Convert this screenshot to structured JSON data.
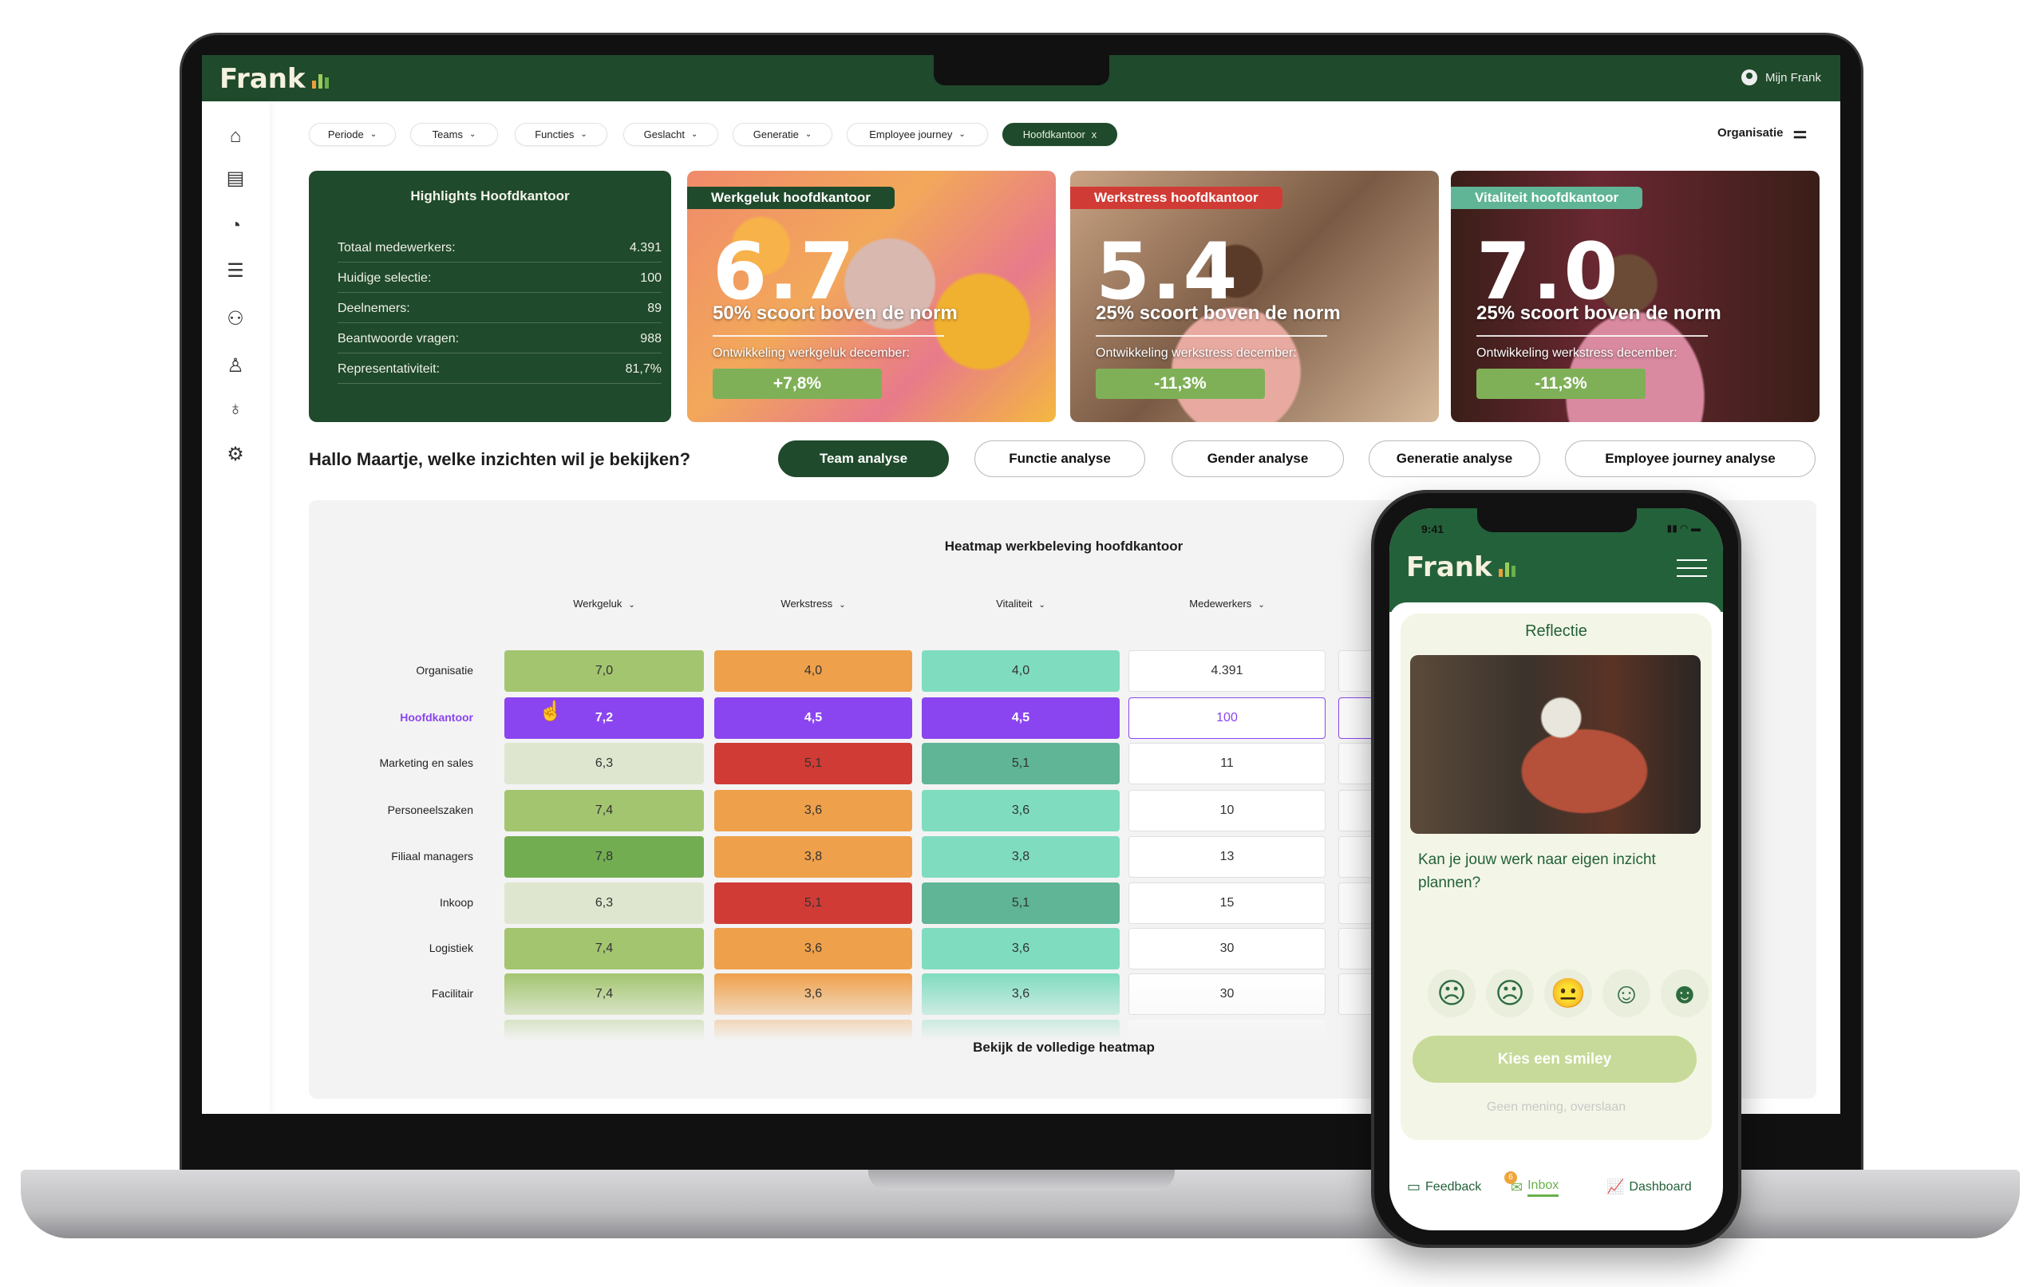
{
  "app": {
    "logo": "Frank",
    "user_label": "Mijn Frank",
    "org_label": "Organisatie",
    "logo_bar_colors": [
      "#e8a03b",
      "#9ccc5a",
      "#6ab04c"
    ]
  },
  "sidebar": {
    "items": [
      {
        "icon": "home-icon"
      },
      {
        "icon": "report-icon"
      },
      {
        "icon": "pie-chart-icon"
      },
      {
        "icon": "sliders-icon"
      },
      {
        "icon": "award-icon"
      },
      {
        "icon": "user-icon"
      },
      {
        "icon": "lightbulb-icon"
      },
      {
        "icon": "gear-icon"
      }
    ]
  },
  "filters": [
    {
      "label": "Periode"
    },
    {
      "label": "Teams"
    },
    {
      "label": "Functies"
    },
    {
      "label": "Geslacht"
    },
    {
      "label": "Generatie"
    },
    {
      "label": "Employee journey"
    },
    {
      "label": "Hoofdkantoor",
      "active": true,
      "close": "x"
    }
  ],
  "highlights": {
    "title": "Highlights Hoofdkantoor",
    "rows": [
      {
        "label": "Totaal medewerkers:",
        "value": "4.391"
      },
      {
        "label": "Huidige selectie:",
        "value": "100"
      },
      {
        "label": "Deelnemers:",
        "value": "89"
      },
      {
        "label": "Beantwoorde vragen:",
        "value": "988"
      },
      {
        "label": "Representativiteit:",
        "value": "81,7%"
      }
    ]
  },
  "score_cards": [
    {
      "tag": "Werkgeluk hoofdkantoor",
      "score": "6.7",
      "norm": "50% scoort boven de norm",
      "development": "Ontwikkeling werkgeluk december:",
      "delta": "+7,8%",
      "tag_color": "#1f4a2b"
    },
    {
      "tag": "Werkstress hoofdkantoor",
      "score": "5.4",
      "norm": "25% scoort boven de norm",
      "development": "Ontwikkeling werkstress december:",
      "delta": "-11,3%",
      "tag_color": "#d13b35"
    },
    {
      "tag": "Vitaliteit hoofdkantoor",
      "score": "7.0",
      "norm": "25% scoort boven de norm",
      "development": "Ontwikkeling werkstress december:",
      "delta": "-11,3%",
      "tag_color": "#5fb596"
    }
  ],
  "question": "Hallo Maartje, welke inzichten wil je bekijken?",
  "analysis_buttons": [
    {
      "label": "Team analyse",
      "active": true
    },
    {
      "label": "Functie analyse"
    },
    {
      "label": "Gender analyse"
    },
    {
      "label": "Generatie analyse"
    },
    {
      "label": "Employee journey analyse"
    }
  ],
  "heatmap": {
    "title": "Heatmap werkbeleving hoofdkantoor",
    "columns": [
      "Werkgeluk",
      "Werkstress",
      "Vitaliteit",
      "Medewerkers"
    ],
    "rows": [
      {
        "label": "Organisatie",
        "cells": [
          [
            "7,0",
            "#a3c56f"
          ],
          [
            "4,0",
            "#efa04b"
          ],
          [
            "4,0",
            "#7fdcbf"
          ],
          [
            "4.391",
            "#ffffff"
          ]
        ]
      },
      {
        "label": "Hoofdkantoor",
        "selected": true,
        "cells": [
          [
            "7,2",
            "#8b45f0"
          ],
          [
            "4,5",
            "#8b45f0"
          ],
          [
            "4,5",
            "#8b45f0"
          ],
          [
            "100",
            "#ffffff"
          ]
        ]
      },
      {
        "label": "Marketing en sales",
        "cells": [
          [
            "6,3",
            "#dfe6cf"
          ],
          [
            "5,1",
            "#d13b35"
          ],
          [
            "5,1",
            "#5fb596"
          ],
          [
            "11",
            "#ffffff"
          ]
        ]
      },
      {
        "label": "Personeelszaken",
        "cells": [
          [
            "7,4",
            "#a3c56f"
          ],
          [
            "3,6",
            "#efa04b"
          ],
          [
            "3,6",
            "#7fdcbf"
          ],
          [
            "10",
            "#ffffff"
          ]
        ]
      },
      {
        "label": "Filiaal managers",
        "cells": [
          [
            "7,8",
            "#72ad52"
          ],
          [
            "3,8",
            "#efa04b"
          ],
          [
            "3,8",
            "#7fdcbf"
          ],
          [
            "13",
            "#ffffff"
          ]
        ]
      },
      {
        "label": "Inkoop",
        "cells": [
          [
            "6,3",
            "#dfe6cf"
          ],
          [
            "5,1",
            "#d13b35"
          ],
          [
            "5,1",
            "#5fb596"
          ],
          [
            "15",
            "#ffffff"
          ]
        ]
      },
      {
        "label": "Logistiek",
        "cells": [
          [
            "7,4",
            "#a3c56f"
          ],
          [
            "3,6",
            "#efa04b"
          ],
          [
            "3,6",
            "#7fdcbf"
          ],
          [
            "30",
            "#ffffff"
          ]
        ]
      },
      {
        "label": "Facilitair",
        "faded": true,
        "cells": [
          [
            "7,4",
            "#a3c56f"
          ],
          [
            "3,6",
            "#efa04b"
          ],
          [
            "3,6",
            "#7fdcbf"
          ],
          [
            "30",
            "#ffffff"
          ]
        ]
      }
    ],
    "selected_color": "#8b45f0",
    "view_full": "Bekijk de volledige heatmap"
  },
  "phone": {
    "time": "9:41",
    "logo": "Frank",
    "card_title": "Reflectie",
    "question": "Kan je jouw werk naar eigen inzicht plannen?",
    "smileys": [
      "very-sad-face-icon",
      "sad-face-icon",
      "neutral-face-icon",
      "happy-face-icon",
      "very-happy-face-icon"
    ],
    "cta": "Kies een smiley",
    "skip": "Geen mening, overslaan",
    "nav": [
      {
        "label": "Feedback",
        "icon": "chat-icon"
      },
      {
        "label": "Inbox",
        "icon": "inbox-icon",
        "badge": "6",
        "active": true
      },
      {
        "label": "Dashboard",
        "icon": "chart-icon"
      }
    ]
  }
}
